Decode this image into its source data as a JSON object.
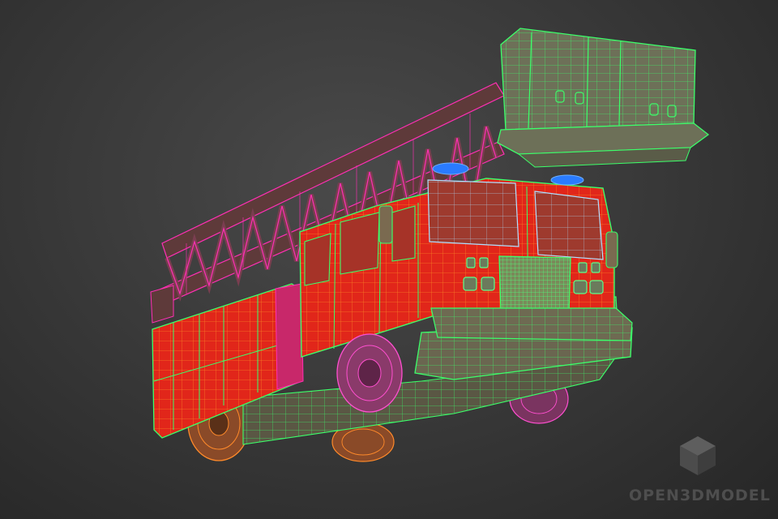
{
  "viewport": {
    "background_top": "#4a4a4a",
    "background_bottom": "#262626"
  },
  "model": {
    "subject": "fire-truck-with-ladder",
    "render_mode": "wireframe-over-shaded",
    "colors": {
      "body": "#e1261a",
      "body_wire": "#ff9a2a",
      "chassis": "#6e6a4e",
      "chassis_wire": "#3cff6a",
      "cab_wire": "#9fd6ff",
      "ladder": "#6a3e3a",
      "ladder_wire": "#ff2fb4",
      "tire_front": "#8a3a6a",
      "tire_wire_front": "#ff4fd0",
      "tire_rear": "#8a4a28",
      "tire_wire_rear": "#ff8a2a",
      "beacon": "#2a7bff",
      "basket": "#6d7058"
    }
  },
  "watermark": {
    "text": "OPEN3DMODEL",
    "logo_icon": "cube-logo-icon",
    "color": "#4e4e4e"
  }
}
